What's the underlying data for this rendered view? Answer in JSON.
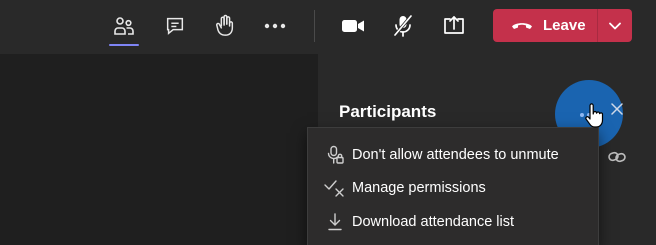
{
  "toolbar": {
    "icons": [
      "people-icon",
      "chat-icon",
      "raise-hand-icon",
      "more-actions-icon",
      "camera-icon",
      "mic-off-icon",
      "share-screen-icon"
    ],
    "leave_label": "Leave",
    "leave_color": "#c4314b",
    "active_underline_color": "#7f85f5"
  },
  "participants_panel": {
    "title": "Participants",
    "more_button_color": "#1a64b0"
  },
  "context_menu": {
    "items": [
      {
        "label": "Don't allow attendees to unmute",
        "icon": "mic-lock-icon"
      },
      {
        "label": "Manage permissions",
        "icon": "check-x-icon"
      },
      {
        "label": "Download attendance list",
        "icon": "download-icon"
      }
    ]
  }
}
